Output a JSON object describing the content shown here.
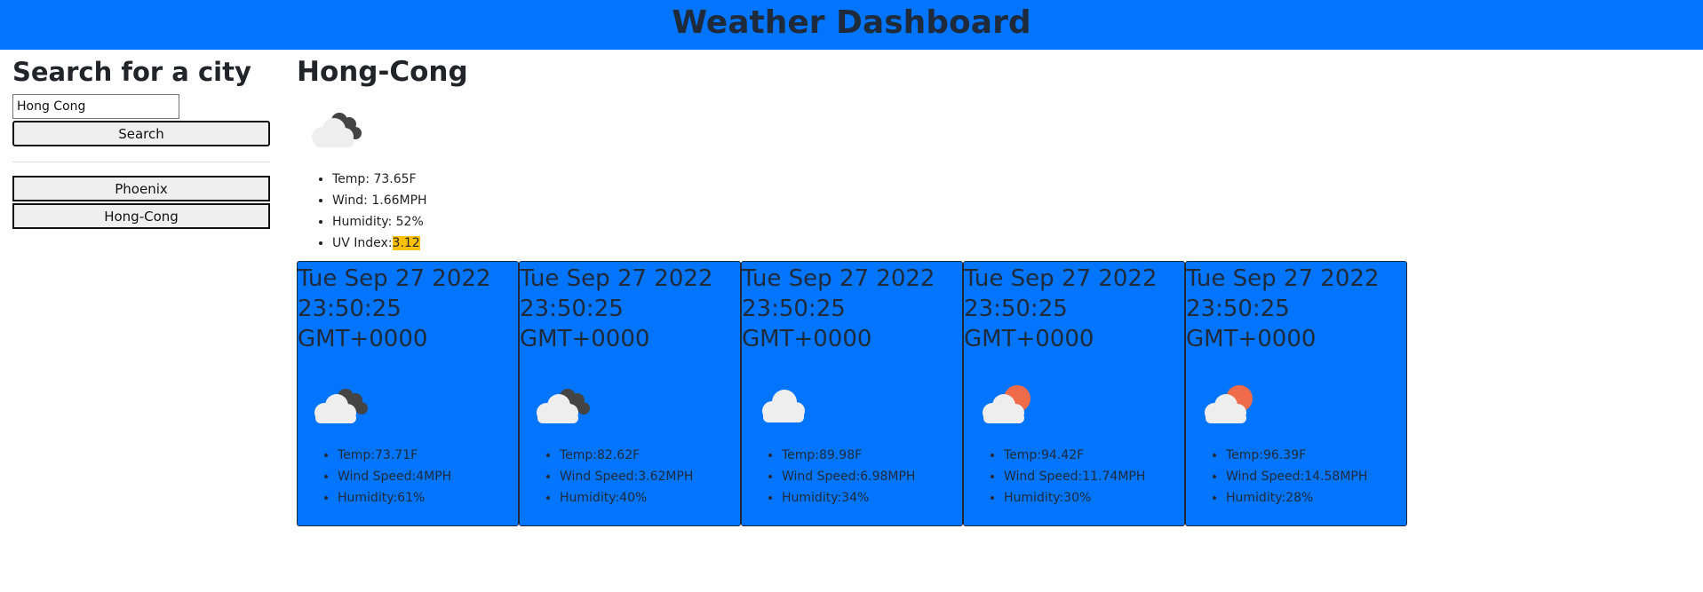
{
  "header": {
    "title": "Weather Dashboard"
  },
  "sidebar": {
    "heading": "Search for a city",
    "search_value": "Hong Cong",
    "search_button": "Search",
    "history": [
      {
        "label": "Phoenix"
      },
      {
        "label": "Hong-Cong"
      }
    ]
  },
  "current": {
    "city": "Hong-Cong",
    "icon": "cloudy-night-icon",
    "temp": "Temp: 73.65F",
    "wind": "Wind: 1.66MPH",
    "humidity": "Humidity: 52%",
    "uv_label": "UV Index:",
    "uv_value": "3.12"
  },
  "forecast": [
    {
      "date": "Tue Sep 27 2022 23:50:25 GMT+0000",
      "icon": "cloudy-night-icon",
      "temp": "Temp:73.71F",
      "wind": "Wind Speed:4MPH",
      "humidity": "Humidity:61%"
    },
    {
      "date": "Tue Sep 27 2022 23:50:25 GMT+0000",
      "icon": "cloudy-night-icon",
      "temp": "Temp:82.62F",
      "wind": "Wind Speed:3.62MPH",
      "humidity": "Humidity:40%"
    },
    {
      "date": "Tue Sep 27 2022 23:50:25 GMT+0000",
      "icon": "cloud-icon",
      "temp": "Temp:89.98F",
      "wind": "Wind Speed:6.98MPH",
      "humidity": "Humidity:34%"
    },
    {
      "date": "Tue Sep 27 2022 23:50:25 GMT+0000",
      "icon": "partly-sunny-icon",
      "temp": "Temp:94.42F",
      "wind": "Wind Speed:11.74MPH",
      "humidity": "Humidity:30%"
    },
    {
      "date": "Tue Sep 27 2022 23:50:25 GMT+0000",
      "icon": "partly-sunny-icon",
      "temp": "Temp:96.39F",
      "wind": "Wind Speed:14.58MPH",
      "humidity": "Humidity:28%"
    }
  ],
  "colors": {
    "header": "#0275fe",
    "card": "#0275fe",
    "uv_badge": "#ffc107",
    "sun": "#ef6b4a",
    "dark_cloud": "#444444"
  }
}
